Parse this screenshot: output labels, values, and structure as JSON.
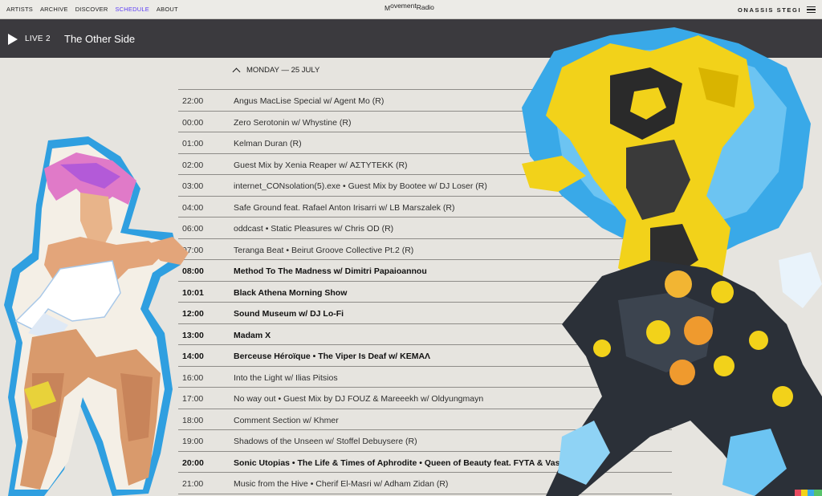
{
  "nav": {
    "links": [
      "ARTISTS",
      "ARCHIVE",
      "DISCOVER",
      "SCHEDULE",
      "ABOUT"
    ],
    "active": "SCHEDULE",
    "logo_1": "M",
    "logo_2": "ovement",
    "logo_3": "Radio",
    "brand": "ONASSIS STEGI",
    "menu_icon": "hamburger-icon"
  },
  "live": {
    "icon": "play-icon",
    "label": "LIVE 2",
    "title": "The Other Side"
  },
  "schedule": {
    "day": "MONDAY — 25 JULY",
    "rows": [
      {
        "time": "22:00",
        "title": "Angus MacLise Special w/ Agent Mo (R)",
        "bold": false
      },
      {
        "time": "00:00",
        "title": "Zero Serotonin w/ Whystine (R)",
        "bold": false
      },
      {
        "time": "01:00",
        "title": "Kelman Duran (R)",
        "bold": false
      },
      {
        "time": "02:00",
        "title": "Guest Mix by Xenia Reaper w/ ΑΣΤΥΤΕΚΚ (R)",
        "bold": false
      },
      {
        "time": "03:00",
        "title": "internet_CONsolation(5).exe • Guest Mix by Bootee w/ DJ Loser (R)",
        "bold": false
      },
      {
        "time": "04:00",
        "title": "Safe Ground feat. Rafael Anton Irisarri w/ LB Marszalek (R)",
        "bold": false
      },
      {
        "time": "06:00",
        "title": "oddcast • Static Pleasures w/ Chris OD (R)",
        "bold": false
      },
      {
        "time": "07:00",
        "title": "Teranga Beat • Beirut Groove Collective Pt.2 (R)",
        "bold": false
      },
      {
        "time": "08:00",
        "title": "Method To The Madness w/ Dimitri Papaioannou",
        "bold": true
      },
      {
        "time": "10:01",
        "title": "Black Athena Morning Show",
        "bold": true
      },
      {
        "time": "12:00",
        "title": "Sound Museum w/ DJ Lo-Fi",
        "bold": true
      },
      {
        "time": "13:00",
        "title": "Madam X",
        "bold": true
      },
      {
        "time": "14:00",
        "title": "Berceuse Héroïque • The Viper Is Deaf w/ ΚΕΜΑΛ",
        "bold": true
      },
      {
        "time": "16:00",
        "title": "Into the Light w/ Ilias Pitsios",
        "bold": false
      },
      {
        "time": "17:00",
        "title": "No way out • Guest Mix by DJ FOUZ & Mareeekh w/ Oldyungmayn",
        "bold": false
      },
      {
        "time": "18:00",
        "title": "Comment Section w/ Khmer",
        "bold": false
      },
      {
        "time": "19:00",
        "title": "Shadows of the Unseen w/ Stoffel Debuysere (R)",
        "bold": false
      },
      {
        "time": "20:00",
        "title": "Sonic Utopias • The Life & Times of Aphrodite • Queen of Beauty feat. FYTA & Vasilis Kostas",
        "bold": true
      },
      {
        "time": "21:00",
        "title": "Music from the Hive • Cherif El-Masri w/ Adham Zidan (R)",
        "bold": false
      }
    ]
  },
  "colors": {
    "background": "#e6e4df",
    "live_bar": "#3b3a3e",
    "active_link": "#5b3cf5"
  }
}
